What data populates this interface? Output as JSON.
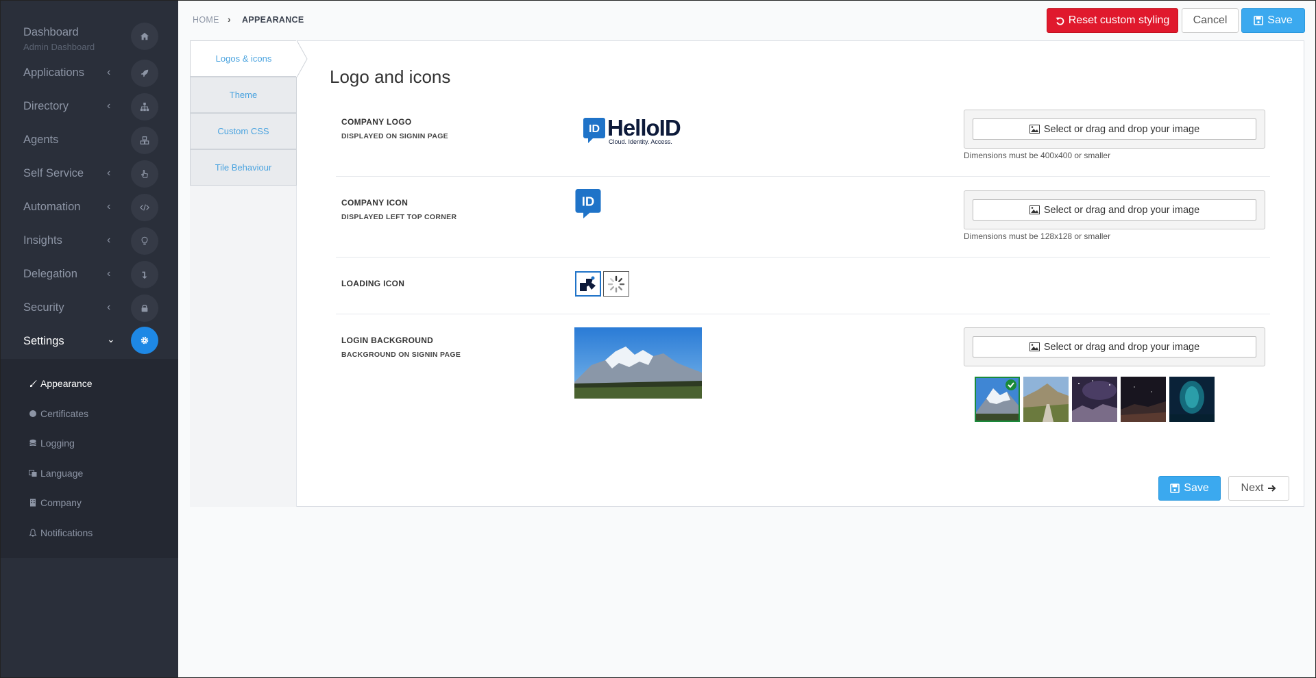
{
  "sidebar": {
    "items": [
      {
        "label": "Dashboard",
        "sublabel": "Admin Dashboard",
        "icon": "home-icon"
      },
      {
        "label": "Applications",
        "icon": "rocket-icon"
      },
      {
        "label": "Directory",
        "icon": "sitemap-icon"
      },
      {
        "label": "Agents",
        "icon": "cubes-icon"
      },
      {
        "label": "Self Service",
        "icon": "hand-pointer-icon"
      },
      {
        "label": "Automation",
        "icon": "code-icon"
      },
      {
        "label": "Insights",
        "icon": "lightbulb-icon"
      },
      {
        "label": "Delegation",
        "icon": "level-down-icon"
      },
      {
        "label": "Security",
        "icon": "lock-icon"
      },
      {
        "label": "Settings",
        "icon": "gear-icon"
      }
    ],
    "submenu": [
      {
        "label": "Appearance",
        "icon": "paint-brush-icon"
      },
      {
        "label": "Certificates",
        "icon": "certificate-icon"
      },
      {
        "label": "Logging",
        "icon": "database-icon"
      },
      {
        "label": "Language",
        "icon": "language-icon"
      },
      {
        "label": "Company",
        "icon": "building-icon"
      },
      {
        "label": "Notifications",
        "icon": "bell-icon"
      }
    ]
  },
  "breadcrumb": {
    "home": "HOME",
    "current": "APPEARANCE"
  },
  "toolbar": {
    "reset_label": "Reset custom styling",
    "cancel_label": "Cancel",
    "save_label": "Save"
  },
  "tabs": [
    "Logos & icons",
    "Theme",
    "Custom CSS",
    "Tile Behaviour"
  ],
  "content": {
    "title": "Logo and icons",
    "logo_brand": {
      "badge": "ID",
      "name": "HelloID",
      "tagline": "Cloud. Identity. Access."
    },
    "rows": {
      "company_logo": {
        "label": "COMPANY LOGO",
        "sub": "DISPLAYED ON SIGNIN PAGE",
        "upload": "Select or drag and drop your image",
        "hint": "Dimensions must be 400x400 or smaller"
      },
      "company_icon": {
        "label": "COMPANY ICON",
        "sub": "DISPLAYED LEFT TOP CORNER",
        "upload": "Select or drag and drop your image",
        "hint": "Dimensions must be 128x128 or smaller"
      },
      "loading_icon": {
        "label": "LOADING ICON"
      },
      "login_background": {
        "label": "LOGIN BACKGROUND",
        "sub": "BACKGROUND ON SIGNIN PAGE",
        "upload": "Select or drag and drop your image"
      }
    }
  },
  "footer": {
    "save_label": "Save",
    "next_label": "Next"
  },
  "colors": {
    "accent": "#3ba9ef",
    "danger": "#e0192d",
    "sidebar": "#2a2f3a",
    "active_icon": "#1e88e5"
  }
}
